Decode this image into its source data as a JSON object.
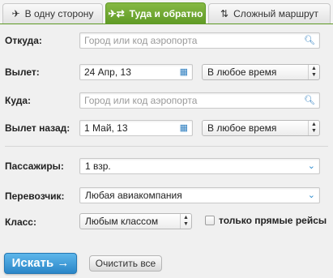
{
  "tabs": [
    {
      "label": "В одну сторону",
      "icon": "plane-icon",
      "active": false
    },
    {
      "label": "Туда и обратно",
      "icon": "round-trip-icon",
      "active": true
    },
    {
      "label": "Сложный маршрут",
      "icon": "multi-route-icon",
      "active": false
    }
  ],
  "form": {
    "from": {
      "label": "Откуда:",
      "placeholder": "Город или код аэропорта",
      "icon": "search-icon"
    },
    "depart": {
      "label": "Вылет:",
      "date": "24 Апр, 13",
      "date_icon": "calendar-icon",
      "time": "В любое время"
    },
    "to": {
      "label": "Куда:",
      "placeholder": "Город или код аэропорта",
      "icon": "search-icon"
    },
    "return": {
      "label": "Вылет назад:",
      "date": "1 Май, 13",
      "date_icon": "calendar-icon",
      "time": "В любое время"
    },
    "passengers": {
      "label": "Пассажиры:",
      "value": "1 взр."
    },
    "carrier": {
      "label": "Перевозчик:",
      "value": "Любая авиакомпания"
    },
    "class": {
      "label": "Класс:",
      "value": "Любым классом"
    },
    "direct_only": {
      "label": "только прямые рейсы",
      "checked": false
    }
  },
  "actions": {
    "search": "Искать →",
    "clear": "Очистить все"
  },
  "colors": {
    "accent_green": "#6ba832",
    "accent_blue": "#2f8ccf",
    "panel_bg": "#f0f0f0"
  }
}
